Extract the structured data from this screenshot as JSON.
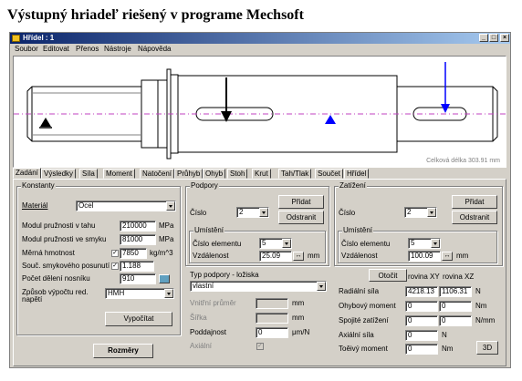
{
  "heading": "Výstupný hriadeľ riešený v programe Mechsoft",
  "window": {
    "title": "Hřídel : 1",
    "buttons": {
      "minimize": "_",
      "maximize": "□",
      "close": "×"
    }
  },
  "menu": [
    "Soubor",
    "Editovat",
    "Přenos",
    "Nástroje",
    "Nápověda"
  ],
  "canvas": {
    "total_length": "Celková délka 303.91 mm"
  },
  "tabs": [
    "Zadání",
    "Výsledky",
    "Síla",
    "Moment",
    "Natočení",
    "Průhyb",
    "Ohyb",
    "Stoh",
    "Krut",
    "Tah/Tlak",
    "Součet",
    "Hřídel"
  ],
  "active_tab": "Zadání",
  "konstanty": {
    "legend": "Konstanty",
    "material_label": "Materiál",
    "material_value": "Ocel",
    "modul_tah_label": "Modul pružnosti v tahu",
    "modul_tah_value": "210000",
    "modul_tah_unit": "MPa",
    "modul_smyk_label": "Modul pružnosti ve smyku",
    "modul_smyk_value": "81000",
    "modul_smyk_unit": "MPa",
    "hmotnost_label": "Měrná hmotnost",
    "hmotnost_value": "7850",
    "hmotnost_unit": "kg/m^3",
    "souc_label": "Souč. smykového posunutí",
    "souc_value": "1.188",
    "deleni_label": "Počet dělení nosníku",
    "deleni_value": "910",
    "zpusob_label_1": "Způsob výpočtu red.",
    "zpusob_label_2": "napětí",
    "zpusob_value": "HMH",
    "vypocitat": "Vypočítat",
    "rozmery": "Rozměry"
  },
  "podpory": {
    "legend": "Podpory",
    "cislo_label": "Číslo",
    "cislo_value": "2",
    "pridat": "Přidat",
    "odstranit": "Odstranit",
    "umisteni_legend": "Umístění",
    "elem_label": "Číslo elementu",
    "elem_value": "5",
    "vzd_label": "Vzdálenost",
    "vzd_value": "25.09",
    "vzd_unit": "mm",
    "typ_label": "Typ podpory - ložiska",
    "typ_value": "vlastní",
    "vnitrni_label": "Vnitřní průměr",
    "vnitrni_unit": "mm",
    "sirka_label": "Šířka",
    "sirka_unit": "mm",
    "poddajnost_label": "Poddajnost",
    "poddajnost_value": "0",
    "poddajnost_unit": "μm/N",
    "axialni_label": "Axiální"
  },
  "zatizeni": {
    "legend": "Zatížení",
    "cislo_label": "Číslo",
    "cislo_value": "2",
    "pridat": "Přidat",
    "odstranit": "Odstranit",
    "umisteni_legend": "Umístění",
    "elem_label": "Číslo elementu",
    "elem_value": "5",
    "vzd_label": "Vzdálenost",
    "vzd_value": "100.09",
    "vzd_unit": "mm",
    "otocit": "Otočit",
    "rovina_xy": "rovina XY",
    "rovina_xz": "rovina XZ",
    "radialni_label": "Radiální síla",
    "radialni_xy": "4218.13",
    "radialni_xz": "1106.31",
    "radialni_unit": "N",
    "ohyb_label": "Ohybový moment",
    "ohyb_xy": "0",
    "ohyb_xz": "0",
    "ohyb_unit": "Nm",
    "spojite_label": "Spojité zatížení",
    "spojite_xy": "0",
    "spojite_xz": "0",
    "spojite_unit": "N/mm",
    "axialni_label": "Axiální síla",
    "axialni_value": "0",
    "axialni_unit": "N",
    "torzni_label": "Toěivý moment",
    "torzni_value": "0",
    "torzni_unit": "Nm",
    "btn3d": "3D"
  },
  "colors": {
    "titlebar_start": "#0a246a",
    "titlebar_end": "#a6caf0",
    "face": "#d4d0c8",
    "axis": "#c040c0",
    "load_arrow": "#0000ff"
  }
}
